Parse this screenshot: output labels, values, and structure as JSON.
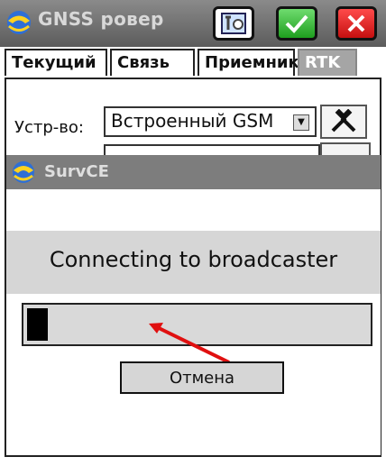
{
  "titlebar": {
    "title": "GNSS ровер"
  },
  "tabs": [
    {
      "label": "Текущий"
    },
    {
      "label": "Связь"
    },
    {
      "label": "Приемник"
    },
    {
      "label": "RTK"
    }
  ],
  "device": {
    "label": "Устр-во:",
    "value": "Встроенный GSM"
  },
  "dialog": {
    "title": "SurvCE",
    "message": "Connecting to broadcaster",
    "progress_fraction": 0.06,
    "cancel_label": "Отмена"
  },
  "colors": {
    "ok": "#1e9e1e",
    "close": "#c51010",
    "annotation": "#e01010"
  }
}
